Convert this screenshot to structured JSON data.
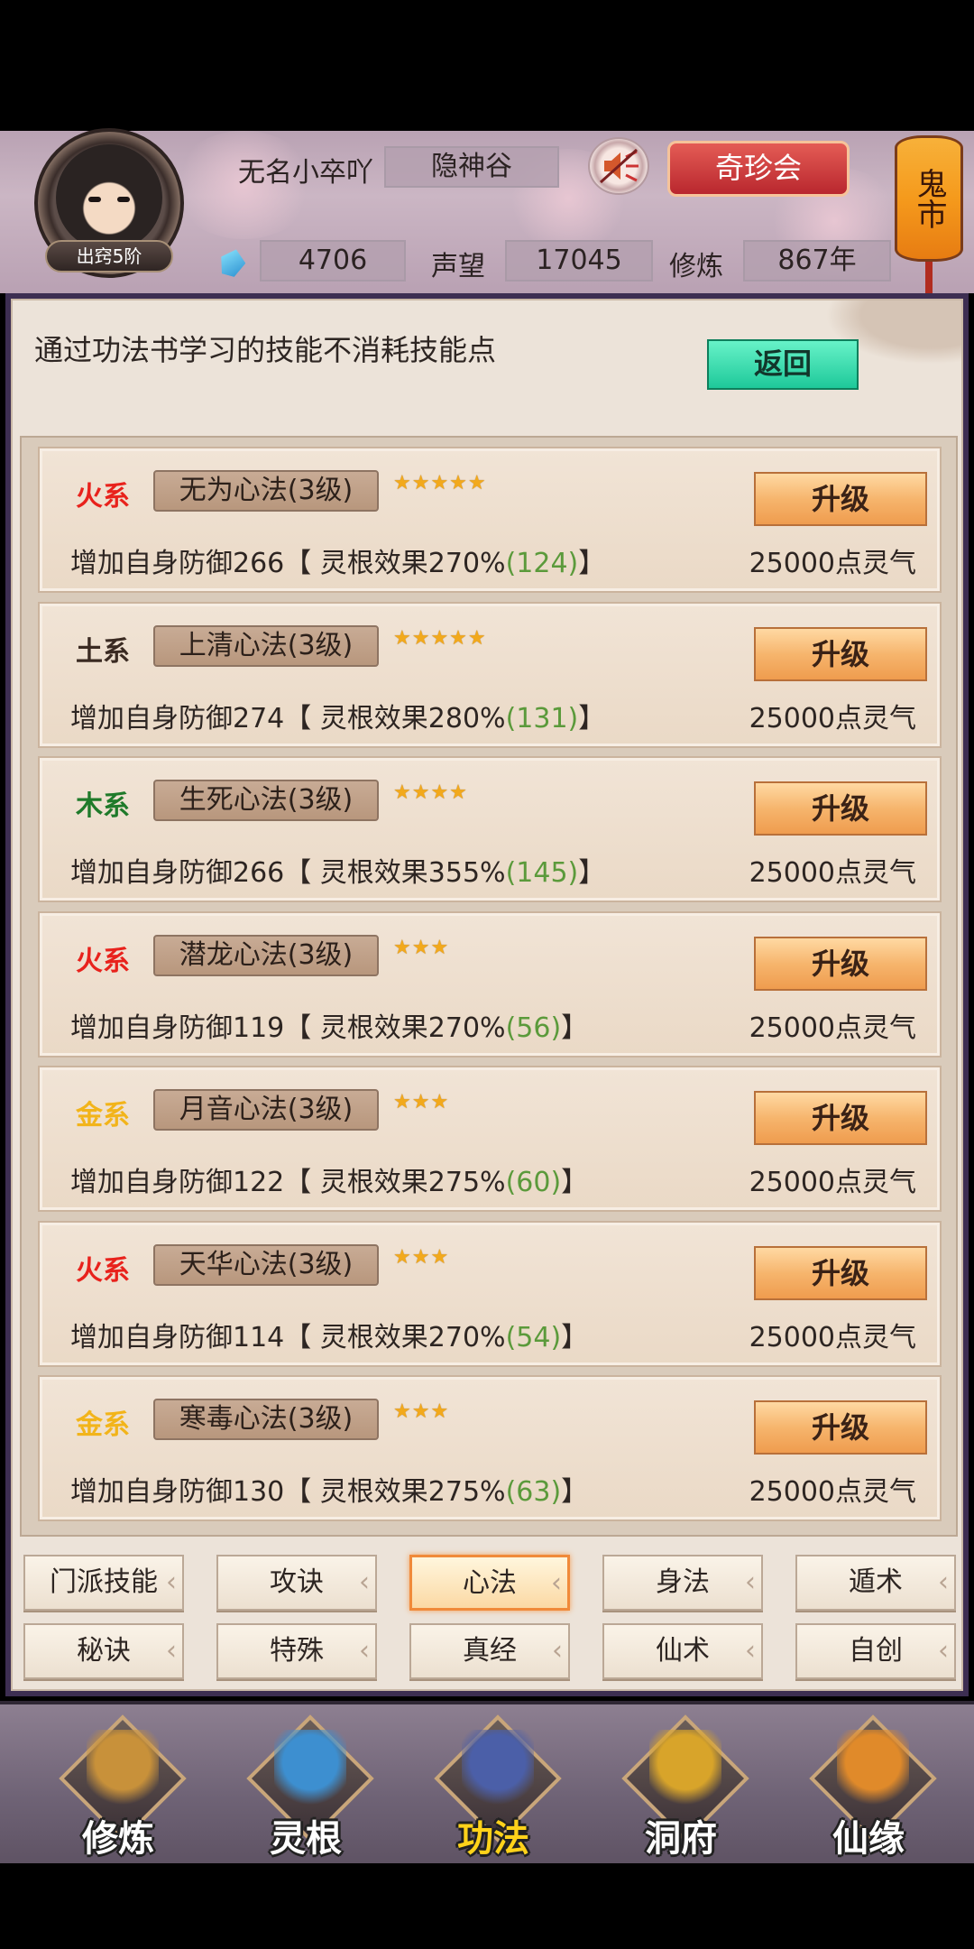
{
  "header": {
    "player_name": "无名小卒吖",
    "sect": "隐神谷",
    "rank": "出窍5阶",
    "gems": "4706",
    "reputation_label": "声望",
    "reputation": "17045",
    "cultivation_label": "修炼",
    "cultivation": "867年",
    "treasure_button": "奇珍会",
    "ghost_market": "鬼市"
  },
  "panel": {
    "hint": "通过功法书学习的技能不消耗技能点",
    "back_button": "返回"
  },
  "skills": [
    {
      "element": "火系",
      "element_color": "#e8221c",
      "name": "无为心法(3级)",
      "stars": "★★★★★",
      "desc": "增加自身防御266【 灵根效果270%",
      "bonus": "(124)",
      "desc_end": "】",
      "cost": "25000点灵气",
      "button": "升级"
    },
    {
      "element": "土系",
      "element_color": "#3a2a22",
      "name": "上清心法(3级)",
      "stars": "★★★★★",
      "desc": "增加自身防御274【 灵根效果280%",
      "bonus": "(131)",
      "desc_end": "】",
      "cost": "25000点灵气",
      "button": "升级"
    },
    {
      "element": "木系",
      "element_color": "#1f7a2a",
      "name": "生死心法(3级)",
      "stars": "★★★★",
      "desc": "增加自身防御266【 灵根效果355%",
      "bonus": "(145)",
      "desc_end": "】",
      "cost": "25000点灵气",
      "button": "升级"
    },
    {
      "element": "火系",
      "element_color": "#e8221c",
      "name": "潜龙心法(3级)",
      "stars": "★★★",
      "desc": "增加自身防御119【 灵根效果270%",
      "bonus": "(56)",
      "desc_end": "】",
      "cost": "25000点灵气",
      "button": "升级"
    },
    {
      "element": "金系",
      "element_color": "#f2b41a",
      "name": "月音心法(3级)",
      "stars": "★★★",
      "desc": "增加自身防御122【 灵根效果275%",
      "bonus": "(60)",
      "desc_end": "】",
      "cost": "25000点灵气",
      "button": "升级"
    },
    {
      "element": "火系",
      "element_color": "#e8221c",
      "name": "天华心法(3级)",
      "stars": "★★★",
      "desc": "增加自身防御114【 灵根效果270%",
      "bonus": "(54)",
      "desc_end": "】",
      "cost": "25000点灵气",
      "button": "升级"
    },
    {
      "element": "金系",
      "element_color": "#f2b41a",
      "name": "寒毒心法(3级)",
      "stars": "★★★",
      "desc": "增加自身防御130【 灵根效果275%",
      "bonus": "(63)",
      "desc_end": "】",
      "cost": "25000点灵气",
      "button": "升级"
    }
  ],
  "tabs": [
    "门派技能",
    "攻诀",
    "心法",
    "身法",
    "遁术",
    "秘诀",
    "特殊",
    "真经",
    "仙术",
    "自创"
  ],
  "active_tab": "心法",
  "nav": [
    {
      "label": "修炼",
      "icon": "monk-icon",
      "color": "#c8913a"
    },
    {
      "label": "灵根",
      "icon": "sword-icon",
      "color": "#3d8fd0"
    },
    {
      "label": "功法",
      "icon": "book-icon",
      "color": "#4b5fa8"
    },
    {
      "label": "洞府",
      "icon": "pavilion-icon",
      "color": "#d8a42a"
    },
    {
      "label": "仙缘",
      "icon": "gourd-icon",
      "color": "#e08a2a"
    }
  ],
  "active_nav": "功法"
}
